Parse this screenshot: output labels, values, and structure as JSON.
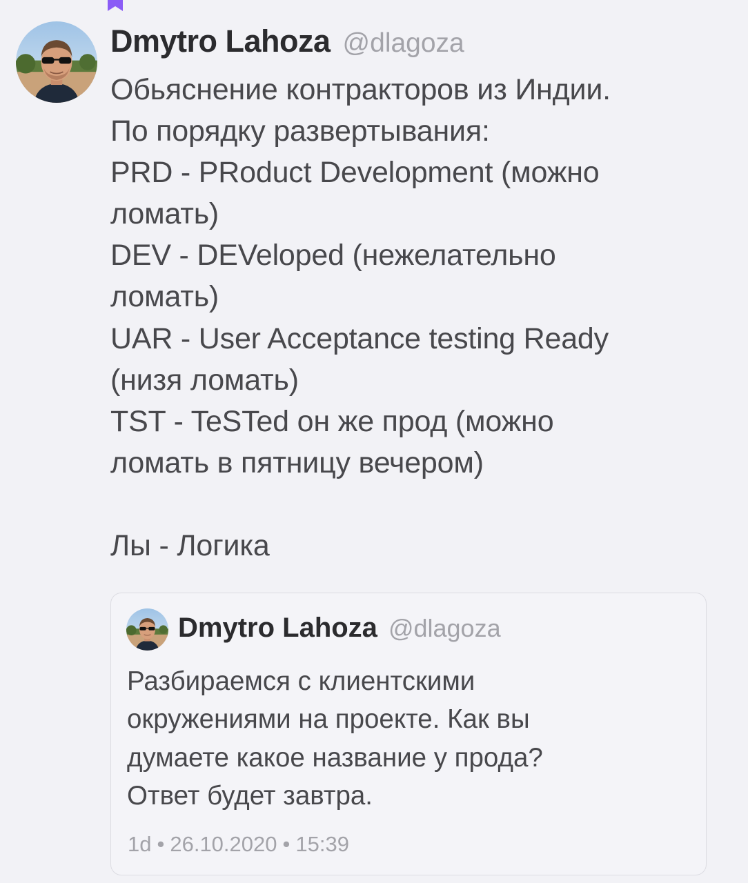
{
  "colors": {
    "accent": "#8b5cf6",
    "background": "#f2f2f6",
    "text_primary": "#48484c",
    "text_secondary": "#a3a3a9",
    "card_border": "#dcdce2"
  },
  "bookmark": {
    "icon": "bookmark-icon"
  },
  "post": {
    "avatar_icon": "user-avatar",
    "author_name": "Dmytro Lahoza",
    "author_handle": "@dlagoza",
    "lines": [
      "Обьяснение контракторов из Индии.",
      "По порядку развертывания:",
      "PRD - PRoduct Development (можно",
      "ломать)",
      "DEV - DEVeloped (нежелательно",
      "ломать)",
      "UAR - User Acceptance testing Ready",
      "(низя ломать)",
      "TST - TeSTed он же прод (можно",
      "ломать в пятницу вечером)",
      "",
      "Лы - Логика"
    ]
  },
  "quoted_post": {
    "avatar_icon": "user-avatar",
    "author_name": "Dmytro Lahoza",
    "author_handle": "@dlagoza",
    "lines": [
      "Разбираемся с клиентскими",
      "окружениями на проекте. Как вы",
      "думаете какое название у прода?",
      "Ответ будет завтра."
    ],
    "age": "1d",
    "date": "26.10.2020",
    "time": "15:39",
    "separator": "•"
  }
}
